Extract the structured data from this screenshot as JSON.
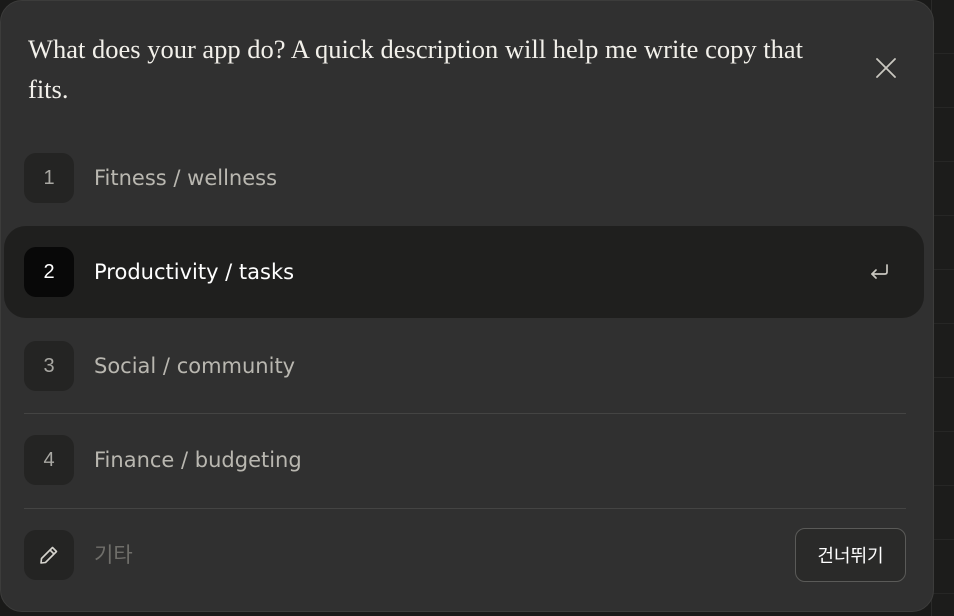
{
  "dialog": {
    "question": "What does your app do? A quick description will help me write copy that fits.",
    "close_icon": "close-icon"
  },
  "options": [
    {
      "number": "1",
      "label": "Fitness / wellness",
      "selected": false
    },
    {
      "number": "2",
      "label": "Productivity / tasks",
      "selected": true
    },
    {
      "number": "3",
      "label": "Social / community",
      "selected": false
    },
    {
      "number": "4",
      "label": "Finance / budgeting",
      "selected": false
    }
  ],
  "selected_indicator_icon": "enter-return-icon",
  "other": {
    "icon": "pencil-icon",
    "placeholder": "기타",
    "value": "",
    "skip_label": "건너뛰기"
  },
  "colors": {
    "dialog_bg": "#303030",
    "selected_row_bg": "#1f1f1e",
    "selected_number_bg": "#080808",
    "text_primary": "#ffffff",
    "text_muted": "#b9b7b0"
  }
}
